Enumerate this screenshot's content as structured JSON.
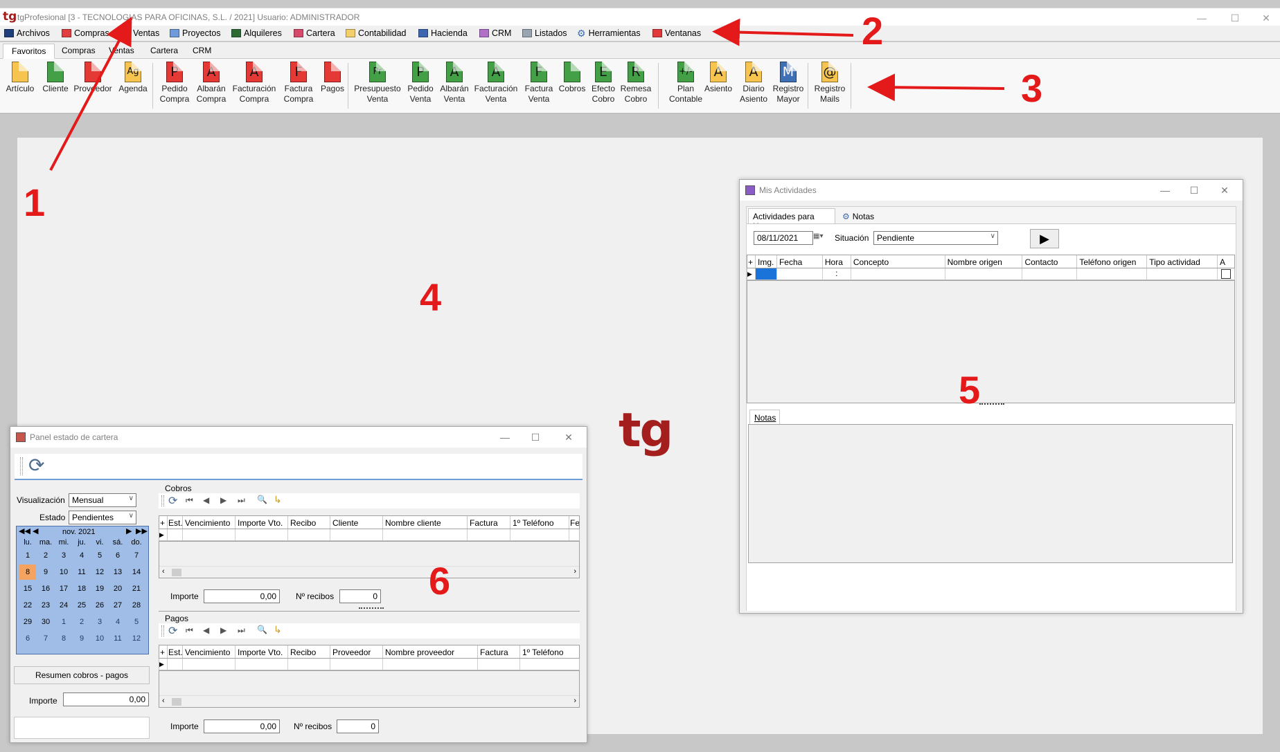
{
  "app": {
    "logo": "tg",
    "title": "tgProfesional [3 - TECNOLOGIAS PARA OFICINAS, S.L. / 2021] Usuario: ADMINISTRADOR"
  },
  "menu": [
    "Archivos",
    "Compras",
    "Ventas",
    "Proyectos",
    "Alquileres",
    "Cartera",
    "Contabilidad",
    "Hacienda",
    "CRM",
    "Listados",
    "Herramientas",
    "Ventanas"
  ],
  "tabs": [
    "Favoritos",
    "Compras",
    "Ventas",
    "Cartera",
    "CRM"
  ],
  "ribbon": [
    {
      "l1": "Artículo",
      "l2": "",
      "glyph": "",
      "color": "yellow"
    },
    {
      "l1": "Cliente",
      "l2": "",
      "glyph": "",
      "color": "green"
    },
    {
      "l1": "Proveedor",
      "l2": "",
      "glyph": "",
      "color": "red"
    },
    {
      "l1": "Agenda",
      "l2": "",
      "glyph": "Ag",
      "color": "yellow"
    },
    {
      "l1": "Pedido",
      "l2": "Compra",
      "glyph": "P",
      "color": "red"
    },
    {
      "l1": "Albarán",
      "l2": "Compra",
      "glyph": "A",
      "color": "red"
    },
    {
      "l1": "Facturación",
      "l2": "Compra",
      "glyph": "A",
      "color": "red"
    },
    {
      "l1": "Factura",
      "l2": "Compra",
      "glyph": "F",
      "color": "red"
    },
    {
      "l1": "Pagos",
      "l2": "",
      "glyph": "",
      "color": "red"
    },
    {
      "l1": "Presupuesto",
      "l2": "Venta",
      "glyph": "Pr",
      "color": "green"
    },
    {
      "l1": "Pedido",
      "l2": "Venta",
      "glyph": "P",
      "color": "green"
    },
    {
      "l1": "Albarán",
      "l2": "Venta",
      "glyph": "A",
      "color": "green"
    },
    {
      "l1": "Facturación",
      "l2": "Venta",
      "glyph": "A",
      "color": "green"
    },
    {
      "l1": "Factura",
      "l2": "Venta",
      "glyph": "F",
      "color": "green"
    },
    {
      "l1": "Cobros",
      "l2": "",
      "glyph": "",
      "color": "green"
    },
    {
      "l1": "Efecto",
      "l2": "Cobro",
      "glyph": "E",
      "color": "green"
    },
    {
      "l1": "Remesa",
      "l2": "Cobro",
      "glyph": "R",
      "color": "green"
    },
    {
      "l1": "Plan",
      "l2": "Contable",
      "glyph": "+/-",
      "color": "green"
    },
    {
      "l1": "Asiento",
      "l2": "",
      "glyph": "A",
      "color": "yellow"
    },
    {
      "l1": "Diario",
      "l2": "Asiento",
      "glyph": "A",
      "color": "yellow"
    },
    {
      "l1": "Registro",
      "l2": "Mayor",
      "glyph": "M",
      "color": "blue"
    },
    {
      "l1": "Registro",
      "l2": "Mails",
      "glyph": "@",
      "color": "yellow"
    }
  ],
  "actividades": {
    "title": "Mis Actividades",
    "tab_hoy": "Actividades para Hoy",
    "tab_notas": "Notas",
    "date": "08/11/2021",
    "situacion_label": "Situación",
    "situacion_value": "Pendiente",
    "columns": [
      "Img.",
      "Fecha",
      "Hora",
      "Concepto",
      "Nombre origen",
      "Contacto",
      "Teléfono origen",
      "Tipo actividad",
      "A"
    ],
    "row_hora": ":",
    "notas_label": "Notas"
  },
  "cartera": {
    "title": "Panel estado de cartera",
    "visualizacion_label": "Visualización",
    "visualizacion_value": "Mensual",
    "estado_label": "Estado",
    "estado_value": "Pendientes",
    "month": "nov. 2021",
    "weekdays": [
      "lu.",
      "ma.",
      "mi.",
      "ju.",
      "vi.",
      "sá.",
      "do."
    ],
    "days": [
      "1",
      "2",
      "3",
      "4",
      "5",
      "6",
      "7",
      "8",
      "9",
      "10",
      "11",
      "12",
      "13",
      "14",
      "15",
      "16",
      "17",
      "18",
      "19",
      "20",
      "21",
      "22",
      "23",
      "24",
      "25",
      "26",
      "27",
      "28",
      "29",
      "30",
      "1",
      "2",
      "3",
      "4",
      "5",
      "6",
      "7",
      "8",
      "9",
      "10",
      "11",
      "12"
    ],
    "resumen": "Resumen cobros - pagos",
    "importe_label": "Importe",
    "importe_value": "0,00",
    "cobros": {
      "label": "Cobros",
      "columns": [
        "Est.",
        "Vencimiento",
        "Importe Vto.",
        "Recibo",
        "Cliente",
        "Nombre cliente",
        "Factura",
        "1º Teléfono",
        "Fe"
      ],
      "importe_label": "Importe",
      "importe_value": "0,00",
      "recibos_label": "Nº recibos",
      "recibos_value": "0"
    },
    "pagos": {
      "label": "Pagos",
      "columns": [
        "Est.",
        "Vencimiento",
        "Importe Vto.",
        "Recibo",
        "Proveedor",
        "Nombre proveedor",
        "Factura",
        "1º Teléfono"
      ],
      "importe_label": "Importe",
      "importe_value": "0,00",
      "recibos_label": "Nº recibos",
      "recibos_value": "0"
    }
  },
  "background_logo": "tg",
  "annotations": [
    "1",
    "2",
    "3",
    "4",
    "5",
    "6"
  ],
  "colors": {
    "brand": "#a41e1e",
    "annotation": "#e41a1a",
    "calendar": "#9fbde6",
    "today": "#f4a460"
  }
}
